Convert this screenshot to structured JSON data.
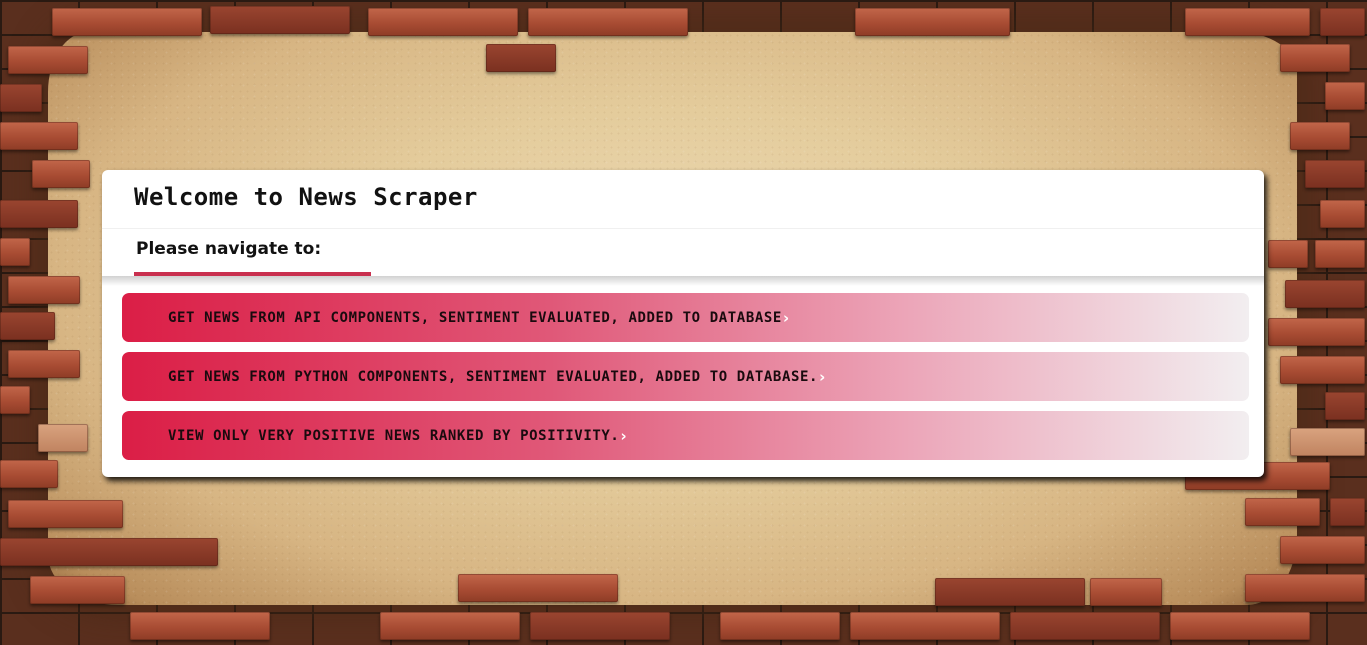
{
  "page": {
    "title": "Welcome to News Scraper",
    "subtitle": "Please navigate to:"
  },
  "nav": {
    "items": [
      {
        "label": "GET NEWS FROM API COMPONENTS, SENTIMENT EVALUATED, ADDED TO DATABASE",
        "icon": "chevron-right-icon"
      },
      {
        "label": "GET NEWS FROM PYTHON COMPONENTS, SENTIMENT EVALUATED, ADDED TO DATABASE.",
        "icon": "chevron-right-icon"
      },
      {
        "label": "VIEW ONLY VERY POSITIVE NEWS RANKED BY POSITIVITY.",
        "icon": "chevron-right-icon"
      }
    ]
  },
  "colors": {
    "accent": "#c9304f",
    "button_gradient_start": "#db1e46",
    "button_gradient_end": "#f2eef0",
    "card_background": "#ffffff"
  }
}
